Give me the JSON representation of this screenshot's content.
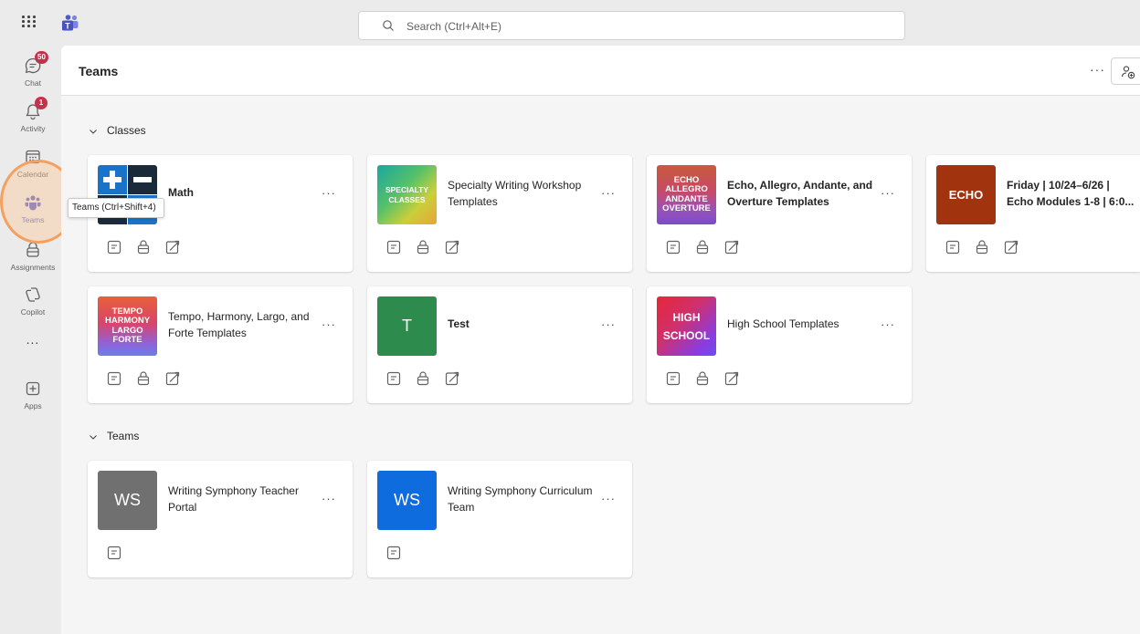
{
  "search": {
    "placeholder": "Search (Ctrl+Alt+E)"
  },
  "rail": {
    "items": [
      {
        "label": "Chat",
        "badge": "50"
      },
      {
        "label": "Activity",
        "badge": "1"
      },
      {
        "label": "Calendar"
      },
      {
        "label": "Teams"
      },
      {
        "label": "Assignments"
      },
      {
        "label": "Copilot"
      },
      {
        "label": "..."
      },
      {
        "label": "Apps"
      }
    ]
  },
  "tooltip": "Teams (Ctrl+Shift+4)",
  "header": {
    "title": "Teams",
    "more": "···"
  },
  "sections": {
    "classes": "Classes",
    "teams": "Teams"
  },
  "cards": [
    {
      "name": "Math",
      "more": "···"
    },
    {
      "name": "Specialty Writing Workshop Templates",
      "tile": [
        "SPECIALTY",
        "CLASSES"
      ],
      "more": "···"
    },
    {
      "name": "Echo, Allegro, Andante, and Overture Templates",
      "tile": [
        "ECHO",
        "ALLEGRO",
        "ANDANTE",
        "OVERTURE"
      ],
      "more": "···"
    },
    {
      "name": "Friday | 10/24–6/26 | Echo Modules 1-8 | 6:0...",
      "tile": [
        "ECHO"
      ]
    },
    {
      "name": "Tempo, Harmony, Largo, and Forte Templates",
      "tile": [
        "TEMPO",
        "HARMONY",
        "LARGO",
        "FORTE"
      ],
      "more": "···"
    },
    {
      "name": "Test",
      "tile": [
        "T"
      ],
      "more": "···"
    },
    {
      "name": "High School Templates",
      "tile": [
        "HIGH",
        "SCHOOL"
      ],
      "more": "···"
    },
    {
      "name": "Writing Symphony Teacher Portal",
      "tile": [
        "WS"
      ],
      "more": "···"
    },
    {
      "name": "Writing Symphony Curriculum Team",
      "tile": [
        "WS"
      ],
      "more": "···"
    }
  ],
  "colors": {
    "accent": "#5b5fc7",
    "badge": "#c4314b",
    "highlight": "#f4a060",
    "test_tile": "#2e8b4e",
    "echo_tile": "#a2330f",
    "ws_gray": "#707070",
    "ws_blue": "#0f6cde"
  }
}
